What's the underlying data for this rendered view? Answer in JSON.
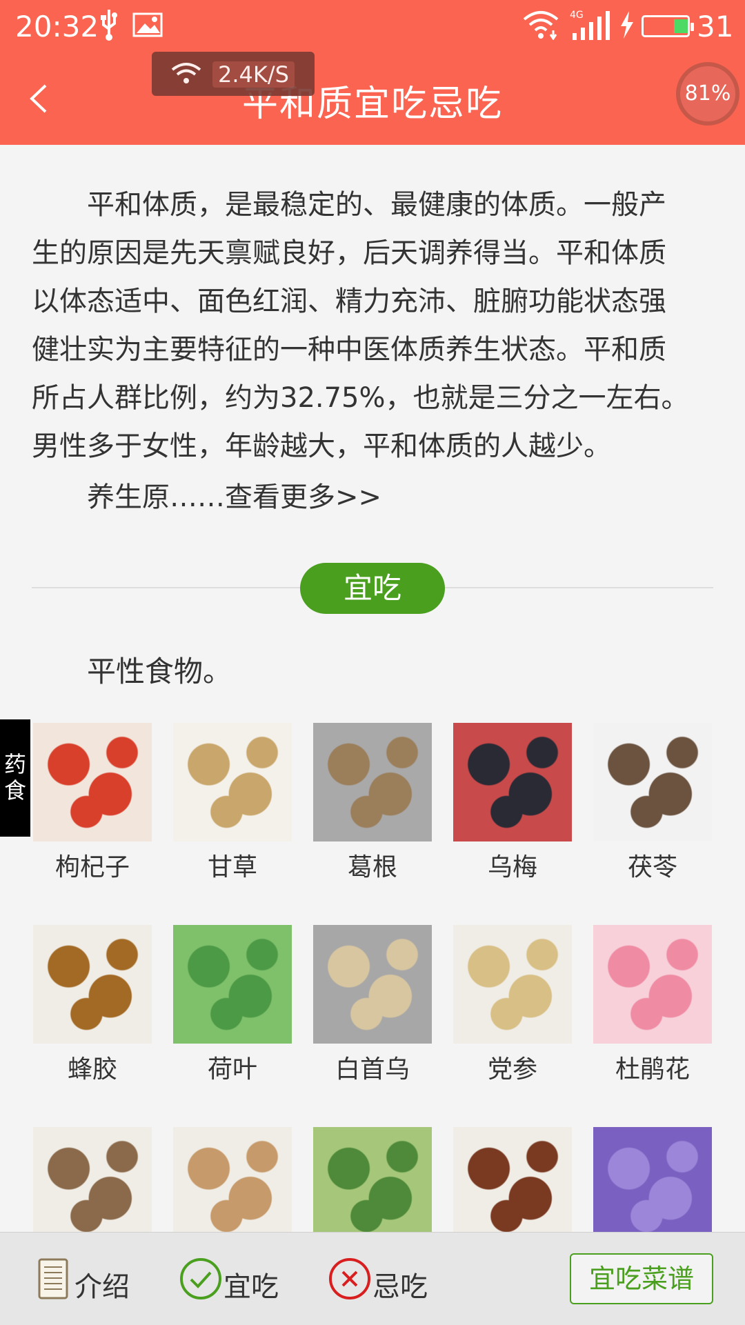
{
  "status_bar": {
    "time": "20:32",
    "network_tag": "4G",
    "battery_level": "31",
    "battery_fraction": 0.31
  },
  "speed_overlay": {
    "speed": "2.4K/S"
  },
  "header": {
    "title": "平和质宜吃忌吃",
    "ring_text": "81%"
  },
  "intro": {
    "lines": [
      "平和体质，是最稳定的、最健康的体质。一般产",
      "生的原因是先天禀赋良好，后天调养得当。平和体质",
      "以体态适中、面色红润、精力充沛、脏腑功能状态强",
      "健壮实为主要特征的一种中医体质养生状态。平和质",
      "所占人群比例，约为32.75%，也就是三分之一左右。",
      "男性多于女性，年龄越大，平和体质的人越少。"
    ],
    "indent": "　　",
    "more": "养生原……查看更多>>"
  },
  "section": {
    "pill": "宜吃",
    "subtitle": "平性食物。"
  },
  "side_tab": {
    "line1": "药",
    "line2": "食"
  },
  "foods": [
    {
      "name": "枸杞子",
      "colors": [
        "#d8402c",
        "#f2e6dc"
      ]
    },
    {
      "name": "甘草",
      "colors": [
        "#c9a66b",
        "#f4f1ea"
      ]
    },
    {
      "name": "葛根",
      "colors": [
        "#9b7e5a",
        "#a9a9a9"
      ]
    },
    {
      "name": "乌梅",
      "colors": [
        "#2a2a35",
        "#c94a4a"
      ]
    },
    {
      "name": "茯苓",
      "colors": [
        "#6b5340",
        "#f2f2f2"
      ]
    },
    {
      "name": "蜂胶",
      "colors": [
        "#a36a25",
        "#f0ede6"
      ]
    },
    {
      "name": "荷叶",
      "colors": [
        "#4c9a46",
        "#7fc06a"
      ]
    },
    {
      "name": "白首乌",
      "colors": [
        "#d8c6a1",
        "#a7a7a7"
      ]
    },
    {
      "name": "党参",
      "colors": [
        "#d8bf86",
        "#f0ede6"
      ]
    },
    {
      "name": "杜鹃花",
      "colors": [
        "#ef8ca4",
        "#f8d0da"
      ]
    },
    {
      "name": "",
      "colors": [
        "#8a6a4a",
        "#f0ede6"
      ]
    },
    {
      "name": "",
      "colors": [
        "#c69a6a",
        "#f0ede6"
      ]
    },
    {
      "name": "",
      "colors": [
        "#4e8a3a",
        "#a6c77a"
      ]
    },
    {
      "name": "",
      "colors": [
        "#7a3a22",
        "#f0ede6"
      ]
    },
    {
      "name": "",
      "colors": [
        "#9b86d9",
        "#7a60c0"
      ]
    }
  ],
  "bottom_nav": {
    "intro_label": "介绍",
    "yichi_label": "宜吃",
    "jichi_label": "忌吃",
    "recipe_label": "宜吃菜谱"
  },
  "colors": {
    "header_bg": "#fb6450",
    "accent_green": "#4a9f1f",
    "jichi_red": "#d81e1e"
  }
}
